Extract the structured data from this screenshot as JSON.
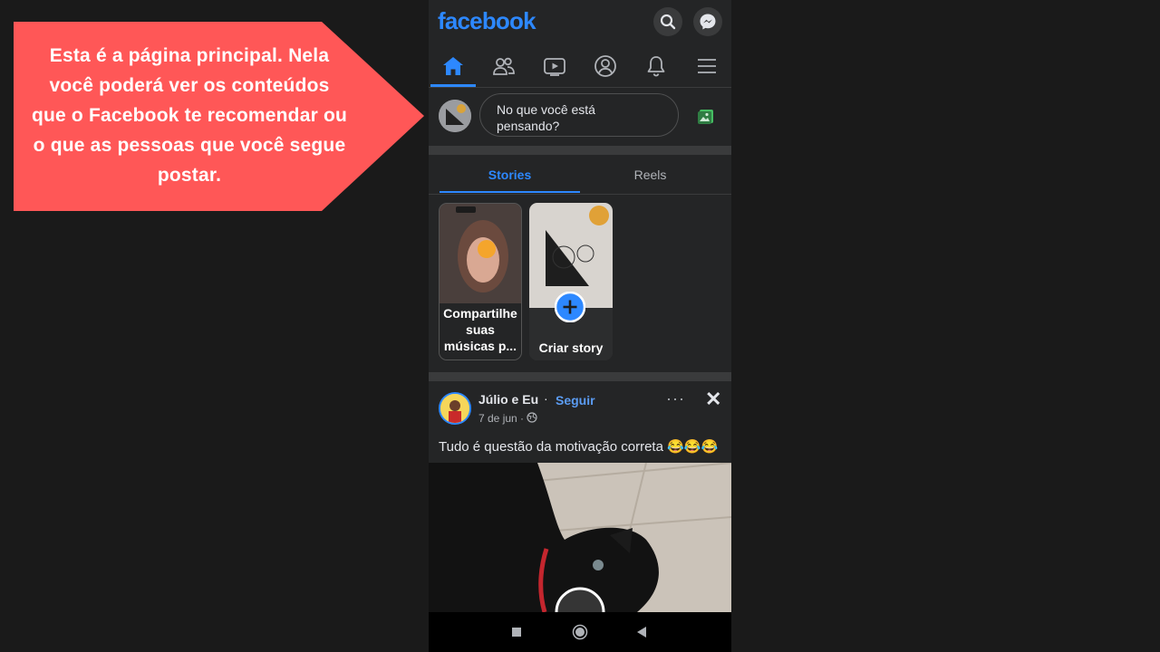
{
  "callout": {
    "text": "Esta é a página principal. Nela você poderá ver os conteúdos que o Facebook te recomendar ou o que as pessoas que você segue postar.",
    "color": "#ff5757"
  },
  "app": {
    "logo": "facebook",
    "brand_color": "#2d88ff",
    "top_icons": [
      "search-icon",
      "messenger-icon"
    ],
    "nav_items": [
      {
        "name": "home-icon",
        "active": true
      },
      {
        "name": "friends-icon",
        "active": false
      },
      {
        "name": "watch-icon",
        "active": false
      },
      {
        "name": "profile-icon",
        "active": false
      },
      {
        "name": "bell-icon",
        "active": false
      },
      {
        "name": "menu-icon",
        "active": false
      }
    ]
  },
  "composer": {
    "placeholder": "No que você está pensando?"
  },
  "tabs": [
    {
      "label": "Stories",
      "active": true
    },
    {
      "label": "Reels",
      "active": false
    }
  ],
  "stories": [
    {
      "title": "Compartilhe suas músicas p..."
    },
    {
      "title": "Criar story"
    }
  ],
  "post": {
    "author": "Júlio e Eu",
    "separator": "·",
    "follow_label": "Seguir",
    "date": "7 de jun ·",
    "more": "···",
    "close": "✕",
    "text": "Tudo é questão da motivação correta 😂😂😂"
  },
  "system_nav": [
    "square-icon",
    "circle-icon",
    "back-triangle-icon"
  ]
}
